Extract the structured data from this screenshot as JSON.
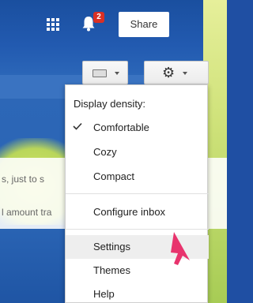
{
  "topbar": {
    "notification_count": "2",
    "share_label": "Share"
  },
  "snippets": [
    "s, just to s",
    "l amount tra"
  ],
  "settings_menu": {
    "header": "Display density:",
    "items": [
      {
        "label": "Comfortable",
        "checked": true
      },
      {
        "label": "Cozy",
        "checked": false
      },
      {
        "label": "Compact",
        "checked": false
      },
      {
        "label": "Configure inbox",
        "checked": false
      },
      {
        "label": "Settings",
        "checked": false,
        "hovered": true
      },
      {
        "label": "Themes",
        "checked": false
      },
      {
        "label": "Help",
        "checked": false
      }
    ]
  },
  "colors": {
    "accent_cursor": "#e8336d",
    "badge": "#d93025",
    "header_blue": "#1f4fa3"
  },
  "icons": [
    "apps-grid-icon",
    "bell-icon",
    "keyboard-icon",
    "gear-icon",
    "check-icon",
    "pointer-cursor-icon"
  ]
}
